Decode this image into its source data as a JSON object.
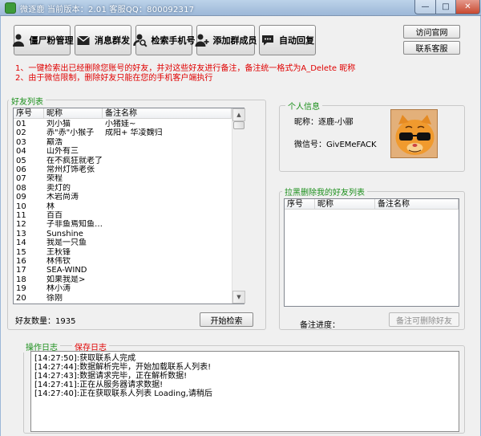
{
  "window": {
    "title": "微逐鹿  当前版本：2.01   客服QQ：800092317",
    "minimize_label": "—",
    "maximize_label": "□",
    "close_label": "✕"
  },
  "toolbar": [
    {
      "label": "僵尸粉管理",
      "icon": "user-group-icon"
    },
    {
      "label": "消息群发",
      "icon": "envelope-icon"
    },
    {
      "label": "检索手机号",
      "icon": "search-user-icon"
    },
    {
      "label": "添加群成员",
      "icon": "add-user-icon"
    },
    {
      "label": "自动回复",
      "icon": "chat-bubble-icon"
    }
  ],
  "side_buttons": {
    "website": "访问官网",
    "support": "联系客服"
  },
  "notices": [
    "1、一键检索出已经删除您账号的好友，并对这些好友进行备注，备注统一格式为A_Delete 昵称",
    "2、由于微信限制，删除好友只能在您的手机客户端执行"
  ],
  "friends_panel": {
    "title": "好友列表",
    "columns": [
      "序号",
      "昵称",
      "备注名称"
    ],
    "rows": [
      [
        "01",
        "刘小猫",
        "小猪娃~"
      ],
      [
        "02",
        "赤\"赤\"小猴子",
        "成阳+ 华凌魏归"
      ],
      [
        "03",
        "巅浩",
        ""
      ],
      [
        "04",
        "山外有三",
        ""
      ],
      [
        "05",
        "在不疯狂就老了",
        ""
      ],
      [
        "06",
        "常州灯饰老张",
        ""
      ],
      [
        "07",
        "荣程",
        ""
      ],
      [
        "08",
        "卖灯的",
        ""
      ],
      [
        "09",
        "木岩尚涛",
        ""
      ],
      [
        "10",
        "林",
        ""
      ],
      [
        "11",
        "百百",
        ""
      ],
      [
        "12",
        "子非鱼焉知鱼…",
        ""
      ],
      [
        "13",
        "Sunshine",
        ""
      ],
      [
        "14",
        "我是一只鱼",
        ""
      ],
      [
        "15",
        "王秋锋",
        ""
      ],
      [
        "16",
        "林伟钦",
        ""
      ],
      [
        "17",
        "SEA-WIND",
        ""
      ],
      [
        "18",
        "如果我是>",
        ""
      ],
      [
        "19",
        "林小涛",
        ""
      ],
      [
        "20",
        "徐刚",
        ""
      ]
    ],
    "count_label": "好友数量：",
    "count_value": "1935",
    "start_button": "开始检索"
  },
  "profile": {
    "title": "个人信息",
    "nickname_label": "昵称：",
    "nickname": "逐鹿-小郦",
    "wechat_label": "微信号：",
    "wechat_id": "GivEMeFACK",
    "avatar_icon": "garfield-sunglasses-icon"
  },
  "blocked_panel": {
    "title": "拉黑删除我的好友列表",
    "columns": [
      "序号",
      "昵称",
      "备注名称"
    ],
    "progress_label": "备注进度：",
    "remark_button": "备注可删除好友"
  },
  "log_panel": {
    "title": "操作日志",
    "save_label": "保存日志",
    "lines": [
      "[14:27:50]:获取联系人完成",
      "[14:27:44]:数据解析完毕，开始加载联系人列表!",
      "[14:27:43]:数据请求完毕，正在解析数据!",
      "[14:27:41]:正在从服务器请求数据!",
      "[14:27:40]:正在获取联系人列表 Loading,请稍后"
    ]
  },
  "colors": {
    "notice": "#e00000",
    "group_title": "#1b8f1b",
    "save_log": "#e00000",
    "titlebar": "#a9c2de"
  }
}
